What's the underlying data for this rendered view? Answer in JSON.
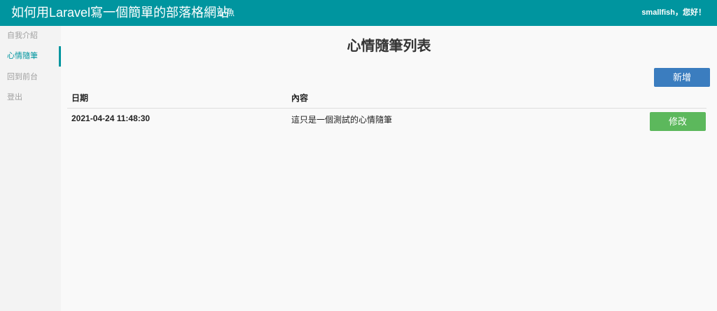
{
  "header": {
    "brand": "如何用Laravel寫一個簡單的部落格網站",
    "subtitle": "小魚",
    "greeting": "smallfish，您好！"
  },
  "sidebar": {
    "items": [
      {
        "label": "自我介紹",
        "active": false
      },
      {
        "label": "心情隨筆",
        "active": true
      },
      {
        "label": "回到前台",
        "active": false
      },
      {
        "label": "登出",
        "active": false
      }
    ]
  },
  "main": {
    "title": "心情隨筆列表",
    "add_button": "新增",
    "columns": [
      "日期",
      "內容"
    ],
    "rows": [
      {
        "date": "2021-04-24 11:48:30",
        "content": "這只是一個測試的心情隨筆",
        "edit_label": "修改"
      }
    ]
  },
  "colors": {
    "accent": "#00959f",
    "add_button": "#3b7dbf",
    "edit_button": "#5cb85c"
  }
}
